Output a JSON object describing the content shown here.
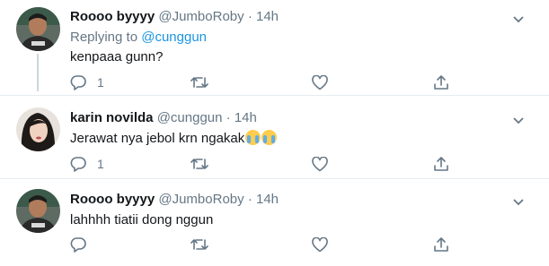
{
  "tweets": [
    {
      "name": "Roooo byyyy",
      "handle": "@JumboRoby",
      "dot": "·",
      "time": "14h",
      "replying_label": "Replying to",
      "replying_to": "@cunggun",
      "text": "kenpaaa gunn?",
      "reply_count": "1",
      "avatar_icon": "profile-photo"
    },
    {
      "name": "karin novilda",
      "handle": "@cunggun",
      "dot": "·",
      "time": "14h",
      "text": "Jerawat nya jebol krn ngakak",
      "emojis": [
        "loudly-crying-face",
        "loudly-crying-face"
      ],
      "reply_count": "1",
      "avatar_icon": "profile-photo"
    },
    {
      "name": "Roooo byyyy",
      "handle": "@JumboRoby",
      "dot": "·",
      "time": "14h",
      "text": "lahhhh tiatii dong nggun",
      "reply_count": "",
      "avatar_icon": "profile-photo"
    }
  ],
  "colors": {
    "text": "#14171a",
    "secondary": "#657786",
    "link": "#1b95e0",
    "divider": "#e6ecf0",
    "thread_line": "#ccd6dd"
  }
}
